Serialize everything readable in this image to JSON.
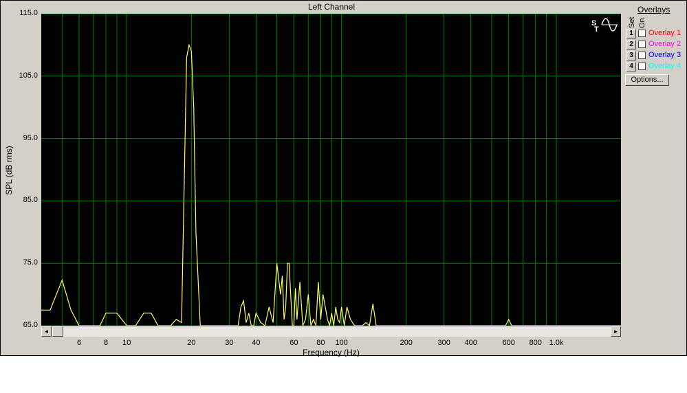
{
  "window": {
    "title": "Left Channel"
  },
  "yaxis": {
    "label": "SPL (dB rms)",
    "ticks": [
      "115.0",
      "105.0",
      "95.0",
      "85.0",
      "75.0",
      "65.0"
    ]
  },
  "xaxis": {
    "label": "Frequency (Hz)",
    "ticks": [
      "6",
      "8",
      "10",
      "20",
      "30",
      "40",
      "60",
      "80",
      "100",
      "200",
      "300",
      "400",
      "600",
      "800",
      "1.0k"
    ]
  },
  "scrollbar": {
    "left_arrow": "◄",
    "right_arrow": "►"
  },
  "overlays": {
    "title": "Overlays",
    "set_header": "Set",
    "on_header": "On",
    "items": [
      {
        "set": "1",
        "label": "Overlay 1",
        "color": "#ff0000",
        "checked": false
      },
      {
        "set": "2",
        "label": "Overlay 2",
        "color": "#ff00ff",
        "checked": false
      },
      {
        "set": "3",
        "label": "Overlay 3",
        "color": "#0000ff",
        "checked": false
      },
      {
        "set": "4",
        "label": "Overlay 4",
        "color": "#00ffff",
        "checked": false
      }
    ],
    "options_button": "Options..."
  },
  "colors": {
    "plot_bg": "#000000",
    "grid": "#008000",
    "trace": "#ffff66"
  },
  "chart_data": {
    "type": "line",
    "xscale": "log",
    "xlim": [
      4,
      2000
    ],
    "ylim": [
      65,
      115
    ],
    "series": [
      {
        "x": [
          4,
          4.4,
          5,
          5.5,
          6,
          6.5,
          7,
          7.5,
          8,
          9,
          10,
          11,
          12,
          13,
          14,
          15,
          16,
          17,
          18,
          19,
          19.5,
          20,
          20.5,
          21,
          22,
          23,
          30,
          33,
          34,
          35,
          36,
          37,
          38,
          39,
          40,
          42,
          44,
          46,
          48,
          50,
          52,
          53,
          54,
          55,
          56,
          57,
          58,
          59,
          60,
          61,
          62,
          64,
          66,
          68,
          70,
          72,
          74,
          76,
          78,
          80,
          82,
          84,
          86,
          88,
          90,
          92,
          94,
          96,
          98,
          100,
          103,
          106,
          110,
          115,
          120,
          125,
          130,
          135,
          140,
          145,
          150,
          155,
          160,
          170,
          200,
          300,
          400,
          500,
          580,
          600,
          620,
          700,
          1000,
          2000
        ],
        "y": [
          67.5,
          67.5,
          72.3,
          67.5,
          65,
          65,
          65,
          65,
          67,
          67,
          65,
          65,
          67,
          67,
          65,
          65,
          65,
          66,
          65.5,
          108,
          110,
          109,
          100,
          80,
          65,
          65,
          65,
          65,
          68,
          69,
          65.5,
          67,
          65,
          65,
          67,
          65.5,
          65,
          68,
          65.5,
          75,
          70,
          73,
          66,
          68,
          75,
          75,
          70,
          65,
          65,
          71,
          66,
          72,
          65,
          66,
          70,
          65,
          66,
          65,
          72,
          66,
          70,
          68,
          66,
          65,
          67,
          65,
          68,
          66,
          65.5,
          68,
          65,
          68,
          66,
          65,
          65,
          65,
          65.5,
          65,
          68.5,
          65,
          65,
          65,
          65,
          65,
          65,
          65,
          65,
          65,
          65,
          66,
          65,
          65,
          65,
          65
        ]
      }
    ]
  }
}
